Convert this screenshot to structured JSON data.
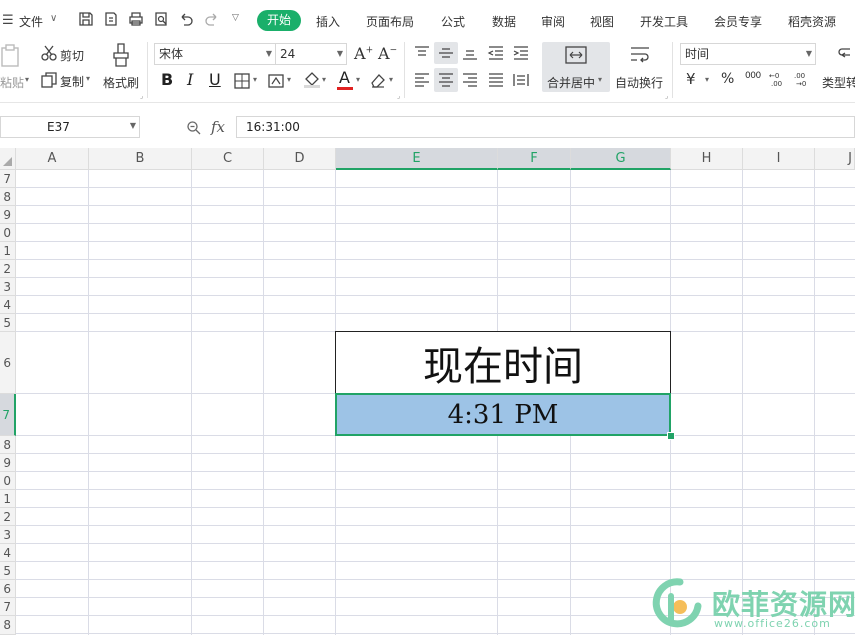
{
  "menubar": {
    "file_label": "文件",
    "tabs": [
      "开始",
      "插入",
      "页面布局",
      "公式",
      "数据",
      "审阅",
      "视图",
      "开发工具",
      "会员专享",
      "稻壳资源"
    ],
    "active_tab": "开始"
  },
  "ribbon": {
    "paste_label": "粘贴",
    "cut_label": "剪切",
    "copy_label": "复制",
    "format_painter_label": "格式刷",
    "font_name": "宋体",
    "font_size": "24",
    "bold": "B",
    "italic": "I",
    "underline": "U",
    "font_color_glyph": "A",
    "merge_center_label": "合并居中",
    "wrap_text_label": "自动换行",
    "number_format": "时间",
    "currency_glyph": "¥",
    "percent_glyph": "%",
    "thousands_glyph": "000",
    "type_convert_label": "类型转",
    "accent_color": "#1aaf6a",
    "font_color_bar": "#e02020"
  },
  "formula_bar": {
    "name_box": "E37",
    "fx_label": "fx",
    "formula": "16:31:00"
  },
  "sheet": {
    "columns": [
      "A",
      "B",
      "C",
      "D",
      "E",
      "F",
      "G",
      "H",
      "I",
      "J"
    ],
    "selected_columns": [
      "E",
      "F",
      "G"
    ],
    "rows": [
      "7",
      "8",
      "9",
      "0",
      "1",
      "2",
      "3",
      "4",
      "5",
      "6",
      "7",
      "8",
      "9",
      "0",
      "1",
      "2",
      "3",
      "4",
      "5",
      "6",
      "7",
      "8"
    ],
    "selected_row": "7",
    "title_cell": "现在时间",
    "time_cell": "4:31 PM",
    "time_cell_fill": "#9dc3e6",
    "selection_color": "#21a366"
  },
  "watermark": {
    "brand_text": "欧菲资源网",
    "url_text": "www.office26.com",
    "color": "#7fd3b0"
  }
}
